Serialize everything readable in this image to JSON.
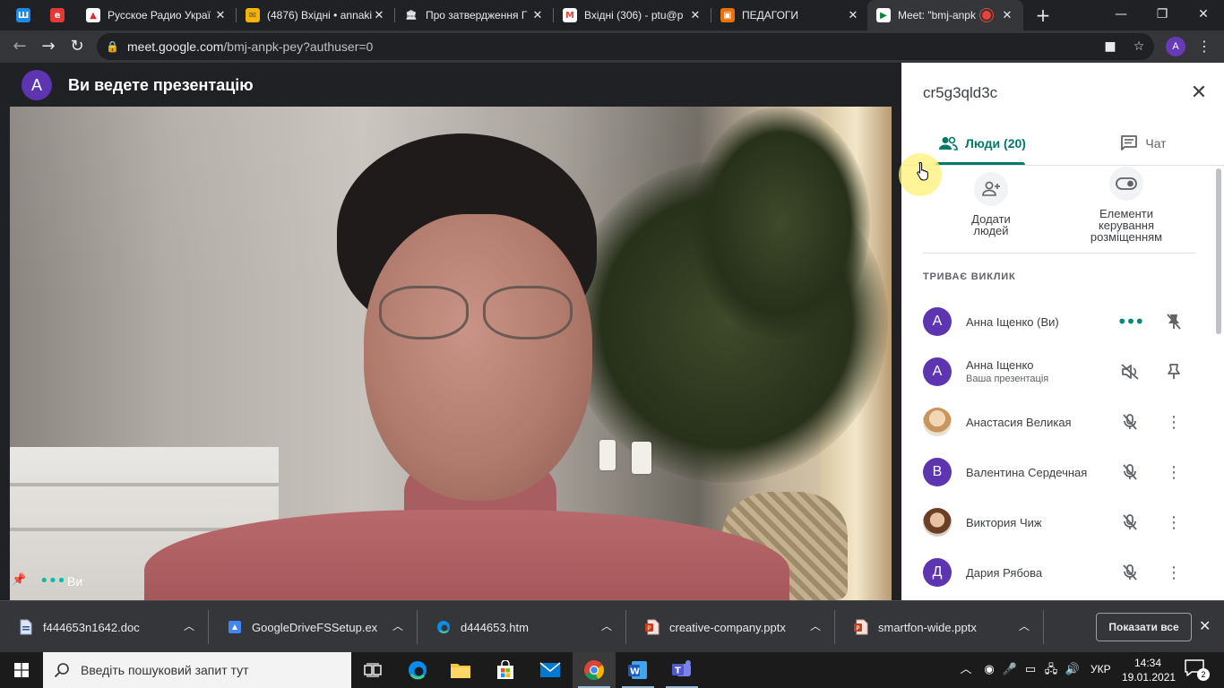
{
  "browser": {
    "tabs": [
      {
        "title": "Русское Радио Украї",
        "close": "✕"
      },
      {
        "title": "(4876) Вхідні • annaki",
        "close": "✕"
      },
      {
        "title": "Про затвердження Г",
        "close": "✕"
      },
      {
        "title": "Вхідні (306) - ptu@p",
        "close": "✕"
      },
      {
        "title": "ПЕДАГОГИ",
        "close": "✕"
      },
      {
        "title": "Meet: \"bmj-anpk",
        "close": "✕"
      }
    ],
    "new_tab": "+",
    "window": {
      "minimize": "—",
      "restore": "❐",
      "close": "✕"
    },
    "url_host": "meet.google.com",
    "url_path": "/bmj-anpk-pey?authuser=0",
    "profile_initial": "A"
  },
  "meet": {
    "presenter_initial": "A",
    "presenting_text": "Ви ведете презентацію",
    "self_label": "Ви",
    "panel": {
      "meeting_code": "cr5g3qld3c",
      "tabs": {
        "people": "Люди (20)",
        "chat": "Чат"
      },
      "actions": {
        "add_people": [
          "Додати",
          "людей"
        ],
        "host_controls": [
          "Елементи",
          "керування",
          "розміщенням"
        ]
      },
      "section_title": "ТРИВАЄ ВИКЛИК",
      "participants": [
        {
          "initial": "А",
          "name": "Анна Іщенко (Ви)",
          "sub": "",
          "color": "#5e35b1"
        },
        {
          "initial": "А",
          "name": "Анна Іщенко",
          "sub": "Ваша презентація",
          "color": "#5e35b1"
        },
        {
          "initial": "",
          "name": "Анастасия Великая",
          "sub": "",
          "color": ""
        },
        {
          "initial": "В",
          "name": "Валентина Сердечная",
          "sub": "",
          "color": "#5e35b1"
        },
        {
          "initial": "",
          "name": "Виктория Чиж",
          "sub": "",
          "color": ""
        },
        {
          "initial": "Д",
          "name": "Дария Рябова",
          "sub": "",
          "color": "#5e35b1"
        }
      ]
    }
  },
  "downloads": {
    "items": [
      {
        "name": "f444653n1642.doc",
        "icon": "doc-icon"
      },
      {
        "name": "GoogleDriveFSSetup.ex",
        "icon": "drive-icon"
      },
      {
        "name": "d444653.htm",
        "icon": "edge-icon"
      },
      {
        "name": "creative-company.pptx",
        "icon": "pptx-icon"
      },
      {
        "name": "smartfon-wide.pptx",
        "icon": "pptx-icon"
      }
    ],
    "show_all": "Показати все"
  },
  "taskbar": {
    "search_placeholder": "Введіть пошуковий запит тут",
    "lang": "УКР",
    "time": "14:34",
    "date": "19.01.2021",
    "notifications": "2"
  },
  "colors": {
    "accent": "#00796b",
    "avatar": "#5e35b1",
    "chrome_dark": "#202124",
    "chrome_bar": "#35363a"
  }
}
